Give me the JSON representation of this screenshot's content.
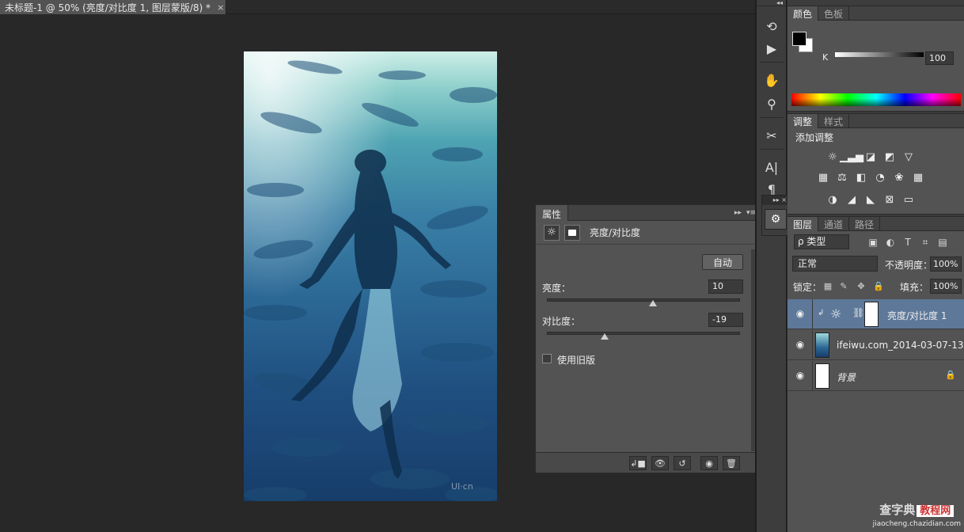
{
  "document": {
    "tab_title": "未标题-1 @ 50% (亮度/对比度 1, 图层蒙版/8) *",
    "close_glyph": "×",
    "watermark": "UI·cn"
  },
  "properties_panel": {
    "tab_label": "属性",
    "collapse_glyph": "▸▸",
    "menu_glyph": "▾≡",
    "layer_title": "亮度/对比度",
    "auto_button": "自动",
    "brightness_label": "亮度：",
    "brightness_value": "10",
    "brightness_fraction": 0.55,
    "contrast_label": "对比度：",
    "contrast_value": "-19",
    "contrast_fraction": 0.3,
    "legacy_checkbox_label": "使用旧版",
    "legacy_checked": false
  },
  "color_panel": {
    "tabs": [
      "颜色",
      "色板"
    ],
    "channel_label": "K",
    "channel_value": "100"
  },
  "adjustments_panel": {
    "tabs": [
      "调整",
      "样式"
    ],
    "title": "添加调整"
  },
  "layers_panel": {
    "tabs": [
      "图层",
      "通道",
      "路径"
    ],
    "kind_filter": "ρ 类型",
    "blend_mode": "正常",
    "opacity_label": "不透明度：",
    "opacity_value": "100%",
    "lock_label": "锁定：",
    "fill_label": "填充：",
    "fill_value": "100%",
    "layers": [
      {
        "name": "亮度/对比度 1",
        "selected": true
      },
      {
        "name": "ifeiwu.com_2014-03-07-13....",
        "selected": false
      },
      {
        "name": "背景",
        "selected": false
      }
    ]
  },
  "site_watermark": {
    "brand": "查字典",
    "box_text": "教程网",
    "url": "jiaocheng.chazidian.com"
  }
}
